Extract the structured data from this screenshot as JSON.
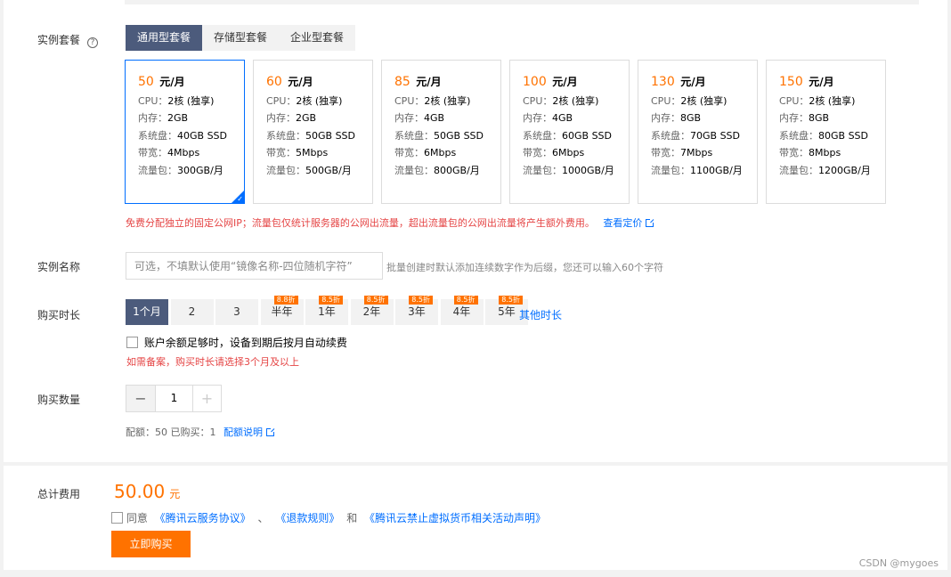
{
  "instance_package": {
    "label": "实例套餐",
    "tabs": [
      "通用型套餐",
      "存储型套餐",
      "企业型套餐"
    ],
    "selected_tab": 0,
    "plans": [
      {
        "price": "50",
        "unit": "元/月",
        "cpu": "2核 (独享)",
        "memory": "2GB",
        "disk": "40GB SSD",
        "bandwidth": "4Mbps",
        "traffic": "300GB/月",
        "selected": true
      },
      {
        "price": "60",
        "unit": "元/月",
        "cpu": "2核 (独享)",
        "memory": "2GB",
        "disk": "50GB SSD",
        "bandwidth": "5Mbps",
        "traffic": "500GB/月",
        "selected": false
      },
      {
        "price": "85",
        "unit": "元/月",
        "cpu": "2核 (独享)",
        "memory": "4GB",
        "disk": "50GB SSD",
        "bandwidth": "6Mbps",
        "traffic": "800GB/月",
        "selected": false
      },
      {
        "price": "100",
        "unit": "元/月",
        "cpu": "2核 (独享)",
        "memory": "4GB",
        "disk": "60GB SSD",
        "bandwidth": "6Mbps",
        "traffic": "1000GB/月",
        "selected": false
      },
      {
        "price": "130",
        "unit": "元/月",
        "cpu": "2核 (独享)",
        "memory": "8GB",
        "disk": "70GB SSD",
        "bandwidth": "7Mbps",
        "traffic": "1100GB/月",
        "selected": false
      },
      {
        "price": "150",
        "unit": "元/月",
        "cpu": "2核 (独享)",
        "memory": "8GB",
        "disk": "80GB SSD",
        "bandwidth": "8Mbps",
        "traffic": "1200GB/月",
        "selected": false
      }
    ],
    "spec_labels": {
      "cpu": "CPU：",
      "memory": "内存：",
      "disk": "系统盘：",
      "bandwidth": "带宽：",
      "traffic": "流量包："
    },
    "note": "免费分配独立的固定公网IP；流量包仅统计服务器的公网出流量，超出流量包的公网出流量将产生额外费用。",
    "pricing_link": "查看定价"
  },
  "instance_name": {
    "label": "实例名称",
    "placeholder": "可选，不填默认使用“镜像名称-四位随机字符”",
    "hint": "批量创建时默认添加连续数字作为后缀，您还可以输入60个字符"
  },
  "duration": {
    "label": "购买时长",
    "options": [
      {
        "label": "1个月",
        "discount": "",
        "active": true
      },
      {
        "label": "2",
        "discount": "",
        "active": false
      },
      {
        "label": "3",
        "discount": "",
        "active": false
      },
      {
        "label": "半年",
        "discount": "8.8折",
        "active": false
      },
      {
        "label": "1年",
        "discount": "8.5折",
        "active": false
      },
      {
        "label": "2年",
        "discount": "8.5折",
        "active": false
      },
      {
        "label": "3年",
        "discount": "8.5折",
        "active": false
      },
      {
        "label": "4年",
        "discount": "8.5折",
        "active": false
      },
      {
        "label": "5年",
        "discount": "8.5折",
        "active": false
      }
    ],
    "other_link": "其他时长",
    "auto_renew": "账户余额足够时，设备到期后按月自动续费",
    "filing_note": "如需备案，购买时长请选择3个月及以上"
  },
  "quantity": {
    "label": "购买数量",
    "minus": "−",
    "value": "1",
    "plus": "+",
    "quota_text": "配额：50  已购买：1",
    "quota_link": "配额说明"
  },
  "total": {
    "label": "总计费用",
    "amount": "50.00",
    "currency": "元",
    "agree_prefix": "同意",
    "link1": "《腾讯云服务协议》",
    "sep1": "、",
    "link2": "《退款规则》",
    "sep2": "和",
    "link3": "《腾讯云禁止虚拟货币相关活动声明》",
    "buy_button": "立即购买"
  },
  "watermark": "CSDN @mygoes",
  "colors": {
    "accent": "#ff7200",
    "link": "#006eff",
    "tab_active": "#4c5b7c",
    "warning": "#e54545"
  }
}
